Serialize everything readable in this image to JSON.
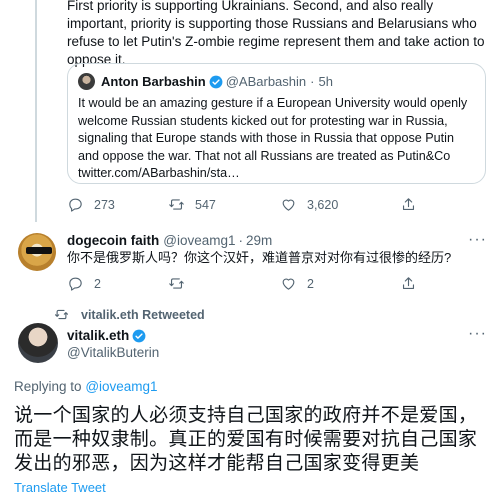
{
  "top_tweet": {
    "text": "First priority is supporting Ukrainians. Second, and also really important, priority is supporting those Russians and Belarusians who refuse to let Putin's Z-ombie regime represent them and take action to oppose it.",
    "quote": {
      "name": "Anton Barbashin",
      "handle": "@ABarbashin",
      "dot": "·",
      "time": "5h",
      "text": "It would be an amazing gesture if a European University would openly welcome Russian students kicked out for protesting war in Russia, signaling that Europe stands with those in Russia that oppose Putin and oppose the war. That not all Russians are treated as Putin&Co twitter.com/ABarbashin/sta…"
    },
    "actions": {
      "replies": "273",
      "retweets": "547",
      "likes": "3,620"
    }
  },
  "reply_tweet": {
    "name": "dogecoin faith",
    "handle": "@ioveamg1",
    "dot": "·",
    "time": "29m",
    "more": "···",
    "text": "你不是俄罗斯人吗？你这个汉奸，难道普京对对你有过很惨的经历?",
    "actions": {
      "replies": "2",
      "retweets": "",
      "likes": "2"
    }
  },
  "retweeted_label": "vitalik.eth Retweeted",
  "main_tweet": {
    "name": "vitalik.eth",
    "handle": "@VitalikButerin",
    "more": "···",
    "replying_prefix": "Replying to",
    "replying_to": "@ioveamg1",
    "text": "说一个国家的人必须支持自己国家的政府并不是爱国，而是一种奴隶制。真正的爱国有时候需要对抗自己国家发出的邪恶，因为这样才能帮自己国家变得更美",
    "translate": "Translate Tweet"
  },
  "colors": {
    "link": "#1d9bf0",
    "muted": "#536471",
    "border": "#cfd9de"
  }
}
